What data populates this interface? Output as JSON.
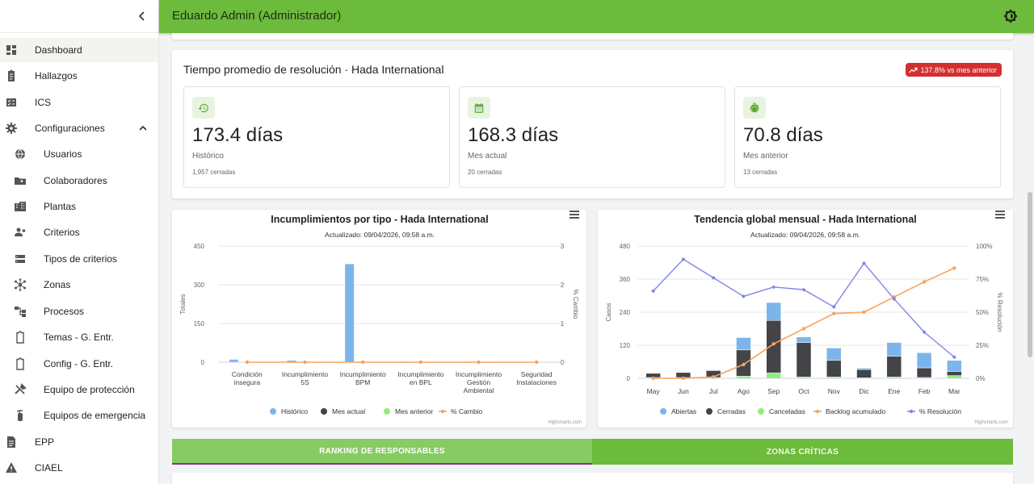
{
  "header": {
    "title": "Eduardo Admin (Administrador)"
  },
  "sidebar": {
    "items": [
      {
        "label": "Dashboard",
        "icon": "dashboard-icon"
      },
      {
        "label": "Hallazgos",
        "icon": "clipboard-icon"
      },
      {
        "label": "ICS",
        "icon": "checklist-icon"
      },
      {
        "label": "Configuraciones",
        "icon": "gear-icon"
      },
      {
        "label": "Usuarios",
        "icon": "globe-icon"
      },
      {
        "label": "Colaboradores",
        "icon": "folder-user-icon"
      },
      {
        "label": "Plantas",
        "icon": "building-icon"
      },
      {
        "label": "Criterios",
        "icon": "person-gear-icon"
      },
      {
        "label": "Tipos de criterios",
        "icon": "storage-icon"
      },
      {
        "label": "Zonas",
        "icon": "hub-icon"
      },
      {
        "label": "Procesos",
        "icon": "flow-icon"
      },
      {
        "label": "Temas - G. Entr.",
        "icon": "clipboard-outline-icon"
      },
      {
        "label": "Config - G. Entr.",
        "icon": "clipboard-outline-icon"
      },
      {
        "label": "Equipo de protección",
        "icon": "tools-icon"
      },
      {
        "label": "Equipos de emergencia",
        "icon": "extinguisher-icon"
      },
      {
        "label": "EPP",
        "icon": "document-icon"
      },
      {
        "label": "CIAEL",
        "icon": "warning-icon"
      }
    ]
  },
  "resolution": {
    "title": "Tiempo promedio de resolución · Hada International",
    "badge": "137.8% vs mes anterior",
    "badge_color": "#d32f2f",
    "stats": [
      {
        "value": "173.4 días",
        "label": "Histórico",
        "detail": "1,957 cerradas",
        "icon": "history-icon"
      },
      {
        "value": "168.3 días",
        "label": "Mes actual",
        "detail": "20 cerradas",
        "icon": "calendar-icon"
      },
      {
        "value": "70.8 días",
        "label": "Mes anterior",
        "detail": "13 cerradas",
        "icon": "timer-icon"
      }
    ]
  },
  "chart_data": [
    {
      "type": "bar",
      "title": "Incumplimientos por tipo - Hada International",
      "subtitle": "Actualizado: 09/04/2026, 09:58 a.m.",
      "ylabel": "Totales",
      "y2label": "% Cambio",
      "ylim": [
        0,
        450
      ],
      "y2lim": [
        0,
        3
      ],
      "yticks": [
        "0",
        "150",
        "300",
        "450"
      ],
      "y2ticks": [
        "0",
        "1",
        "2",
        "3"
      ],
      "categories": [
        [
          "Condición",
          "insegura"
        ],
        [
          "Incumplimiento",
          "5S"
        ],
        [
          "Incumplimiento",
          "BPM"
        ],
        [
          "Incumplimiento",
          "en BPL"
        ],
        [
          "Incumplimiento",
          "Gestión",
          "Ambiental"
        ],
        [
          "Seguridad",
          "Instalaciones"
        ]
      ],
      "series": [
        {
          "name": "Histórico",
          "type": "bar",
          "color": "#7cb5ec",
          "values": [
            10,
            6,
            380,
            2,
            2,
            1
          ]
        },
        {
          "name": "Mes actual",
          "type": "bar",
          "color": "#434348",
          "values": [
            0,
            0,
            0,
            0,
            0,
            0
          ]
        },
        {
          "name": "Mes anterior",
          "type": "bar",
          "color": "#90ed7d",
          "values": [
            0,
            0,
            0,
            0,
            0,
            0
          ]
        },
        {
          "name": "% Cambio",
          "type": "line",
          "axis": "right",
          "color": "#f7a35c",
          "values": [
            0,
            0,
            0,
            0,
            0,
            0
          ]
        }
      ],
      "credit": "Highcharts.com"
    },
    {
      "type": "bar",
      "title": "Tendencia global mensual - Hada International",
      "subtitle": "Actualizado: 09/04/2026, 09:58 a.m.",
      "ylabel": "Casos",
      "y2label": "% Resolución",
      "ylim": [
        0,
        480
      ],
      "y2lim": [
        0,
        100
      ],
      "yticks": [
        "0",
        "120",
        "240",
        "360",
        "480"
      ],
      "y2ticks": [
        "0%",
        "25%",
        "50%",
        "75%",
        "100%"
      ],
      "categories": [
        "May",
        "Jun",
        "Jul",
        "Ago",
        "Sep",
        "Oct",
        "Nov",
        "Dic",
        "Ene",
        "Feb",
        "Mar"
      ],
      "series": [
        {
          "name": "Abiertas",
          "type": "stacked-bar",
          "color": "#7cb5ec",
          "values": [
            0,
            0,
            0,
            45,
            65,
            20,
            45,
            5,
            50,
            55,
            40
          ]
        },
        {
          "name": "Cerradas",
          "type": "stacked-bar",
          "color": "#434348",
          "values": [
            15,
            18,
            25,
            95,
            190,
            125,
            60,
            30,
            75,
            35,
            15
          ]
        },
        {
          "name": "Canceladas",
          "type": "stacked-bar",
          "color": "#90ed7d",
          "values": [
            3,
            3,
            3,
            8,
            20,
            5,
            5,
            2,
            5,
            3,
            10
          ]
        },
        {
          "name": "Backlog acumulado",
          "type": "line",
          "axis": "left",
          "color": "#f7a35c",
          "values": [
            0,
            0,
            5,
            50,
            125,
            180,
            235,
            240,
            295,
            350,
            400
          ]
        },
        {
          "name": "% Resolución",
          "type": "line",
          "axis": "right",
          "color": "#8085e9",
          "values": [
            66,
            90,
            76,
            62,
            69,
            67,
            54,
            87,
            60,
            35,
            16
          ]
        }
      ],
      "credit": "Highcharts.com"
    }
  ],
  "tabs": [
    {
      "label": "RANKING DE RESPONSABLES"
    },
    {
      "label": "ZONAS CRÍTICAS"
    }
  ]
}
